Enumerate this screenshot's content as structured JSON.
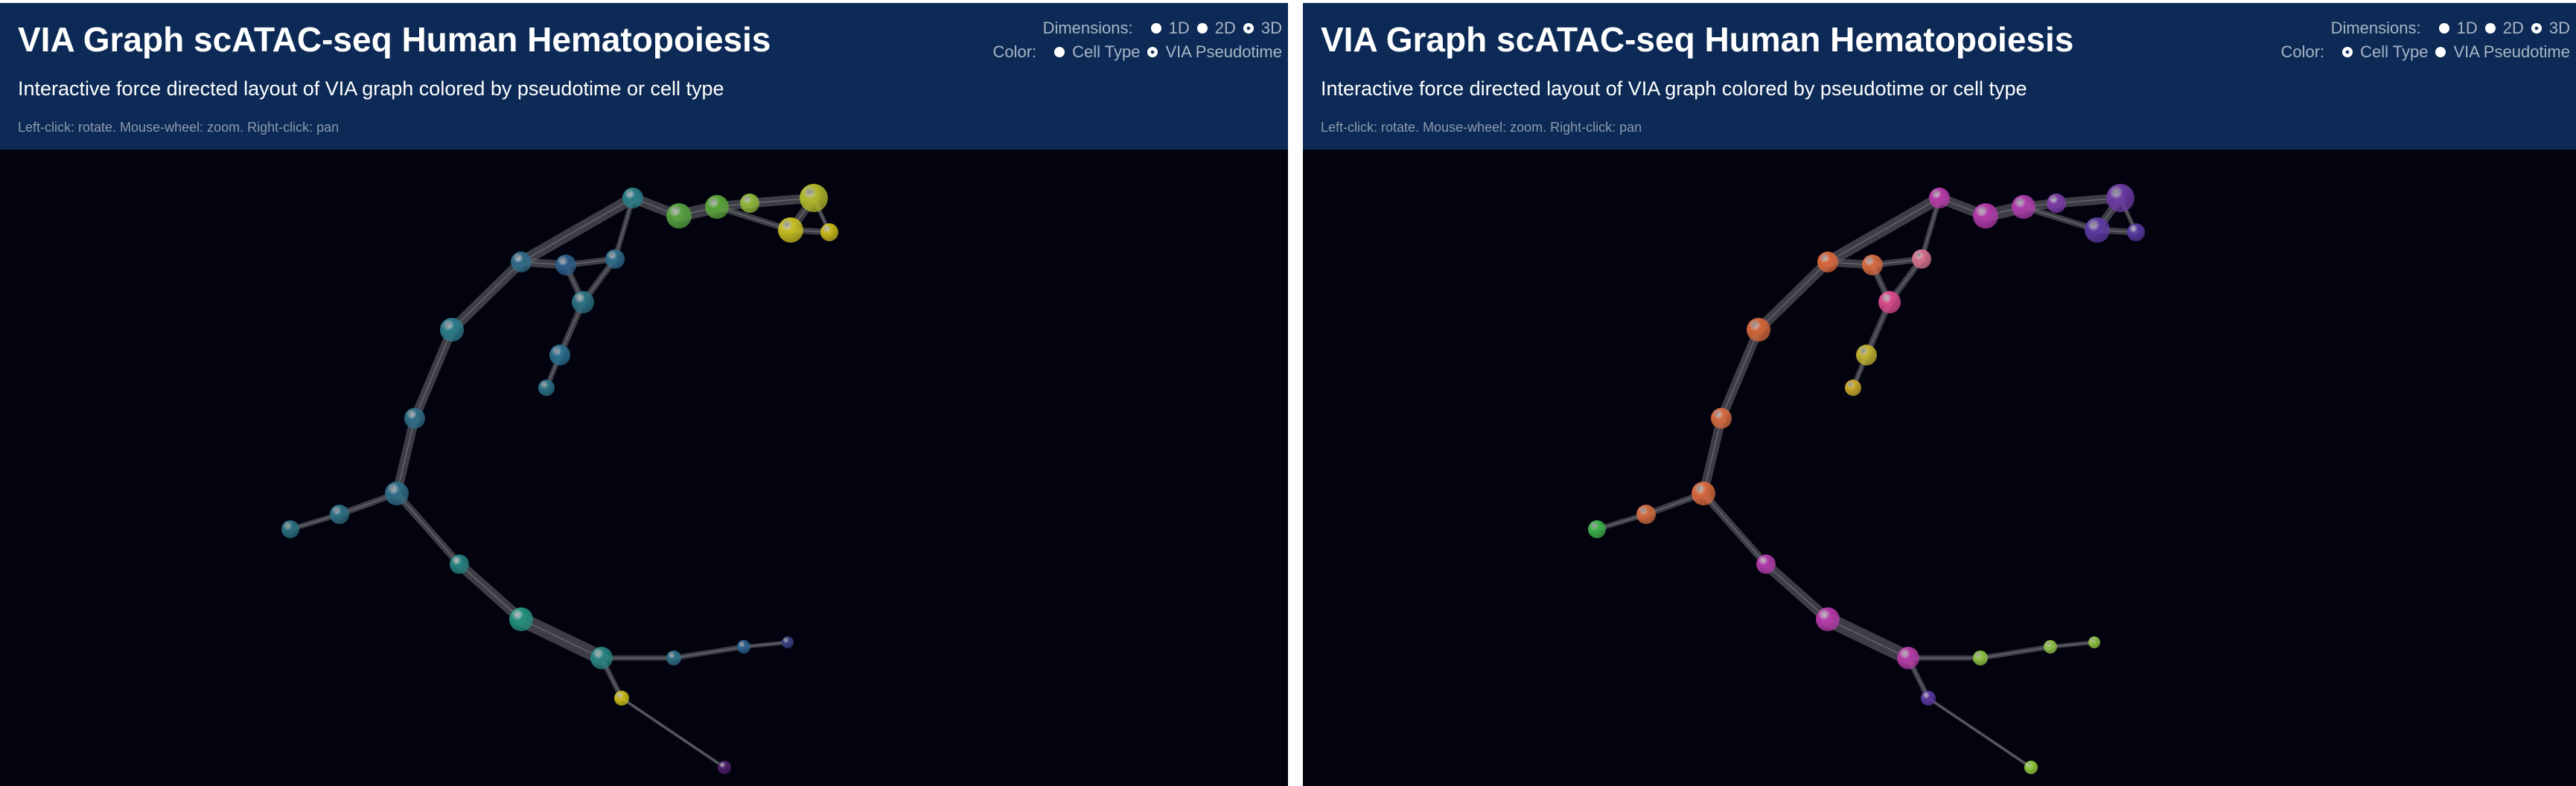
{
  "panels": [
    {
      "title": "VIA Graph scATAC-seq Human Hematopoiesis",
      "subtitle": "Interactive force directed layout of VIA graph colored by pseudotime or cell type",
      "hint": "Left-click: rotate. Mouse-wheel: zoom. Right-click: pan",
      "dimensions_label": "Dimensions:",
      "dimension_options": [
        "1D",
        "2D",
        "3D"
      ],
      "dimension_selected": "3D",
      "color_label": "Color:",
      "color_options": [
        "Cell Type",
        "VIA Pseudotime"
      ],
      "color_selected": "VIA Pseudotime",
      "node_colors": [
        "#2a6f7d",
        "#2d6e80",
        "#2e6c84",
        "#2e6c84",
        "#2b7a88",
        "#2f6a86",
        "#2c5c86",
        "#2d6a88",
        "#2a6f80",
        "#2a6e8c",
        "#2b7084",
        "#24807e",
        "#24907c",
        "#27827f",
        "#2a7d86",
        "#55a040",
        "#5aa33a",
        "#8fb53a",
        "#b0b72a",
        "#c4bd22",
        "#c6b81a",
        "#c7b91b",
        "#2c6c82",
        "#2d5f8c",
        "#3a3f80",
        "#4a2068",
        "#4f1c60",
        "#50196b",
        "#4e1a66"
      ]
    },
    {
      "title": "VIA Graph scATAC-seq Human Hematopoiesis",
      "subtitle": "Interactive force directed layout of VIA graph colored by pseudotime or cell type",
      "hint": "Left-click: rotate. Mouse-wheel: zoom. Right-click: pan",
      "dimensions_label": "Dimensions:",
      "dimension_options": [
        "1D",
        "2D",
        "3D"
      ],
      "dimension_selected": "3D",
      "color_label": "Color:",
      "color_options": [
        "Cell Type",
        "VIA Pseudotime"
      ],
      "color_selected": "Cell Type",
      "node_colors": [
        "#3cb04a",
        "#d06a3e",
        "#d4673c",
        "#d36a40",
        "#d0663a",
        "#d8663a",
        "#d46a40",
        "#d4708a",
        "#d64a8a",
        "#c0b030",
        "#c8a82a",
        "#b03aa8",
        "#b63aa8",
        "#b23aa4",
        "#b43aa6",
        "#b03aa8",
        "#aa3ca8",
        "#7a3aa4",
        "#6a3aa0",
        "#5c3aa0",
        "#56389c",
        "#5a389e",
        "#8ec042",
        "#8ec046",
        "#8ec040",
        "#8ec83a",
        "#20a890",
        "#28b08e",
        "#c43a80"
      ]
    }
  ],
  "graph": {
    "nodes": [
      [
        390,
        711,
        12
      ],
      [
        456,
        691,
        13
      ],
      [
        533,
        663,
        16
      ],
      [
        557,
        562,
        14
      ],
      [
        607,
        443,
        16
      ],
      [
        700,
        352,
        14
      ],
      [
        760,
        356,
        14
      ],
      [
        826,
        348,
        13
      ],
      [
        783,
        406,
        15
      ],
      [
        752,
        477,
        14
      ],
      [
        734,
        521,
        11
      ],
      [
        617,
        758,
        13
      ],
      [
        700,
        832,
        16
      ],
      [
        808,
        884,
        15
      ],
      [
        850,
        266,
        14
      ],
      [
        912,
        290,
        17
      ],
      [
        963,
        278,
        16
      ],
      [
        1007,
        273,
        13
      ],
      [
        1093,
        266,
        19
      ],
      [
        1062,
        309,
        17
      ],
      [
        1114,
        312,
        12
      ],
      [
        835,
        938,
        10
      ],
      [
        905,
        884,
        10
      ],
      [
        999,
        869,
        9
      ],
      [
        1058,
        863,
        8
      ],
      [
        973,
        1031,
        9
      ],
      [
        904,
        881,
        9
      ],
      [
        835,
        938,
        10
      ],
      [
        808,
        884,
        15
      ]
    ],
    "edges": [
      [
        0,
        1,
        5
      ],
      [
        1,
        2,
        6
      ],
      [
        2,
        3,
        9
      ],
      [
        3,
        4,
        9
      ],
      [
        4,
        5,
        10
      ],
      [
        5,
        6,
        8
      ],
      [
        5,
        14,
        11
      ],
      [
        6,
        7,
        6
      ],
      [
        6,
        8,
        6
      ],
      [
        7,
        8,
        6
      ],
      [
        7,
        14,
        5
      ],
      [
        8,
        9,
        6
      ],
      [
        9,
        10,
        5
      ],
      [
        14,
        15,
        10
      ],
      [
        15,
        16,
        12
      ],
      [
        16,
        17,
        9
      ],
      [
        17,
        18,
        9
      ],
      [
        16,
        19,
        6
      ],
      [
        18,
        19,
        8
      ],
      [
        19,
        20,
        6
      ],
      [
        18,
        20,
        4
      ],
      [
        2,
        11,
        7
      ],
      [
        11,
        12,
        10
      ],
      [
        12,
        13,
        14
      ],
      [
        13,
        22,
        5
      ],
      [
        22,
        23,
        5
      ],
      [
        23,
        24,
        4
      ],
      [
        13,
        21,
        5
      ],
      [
        21,
        25,
        3
      ],
      [
        2,
        12,
        3
      ]
    ]
  }
}
